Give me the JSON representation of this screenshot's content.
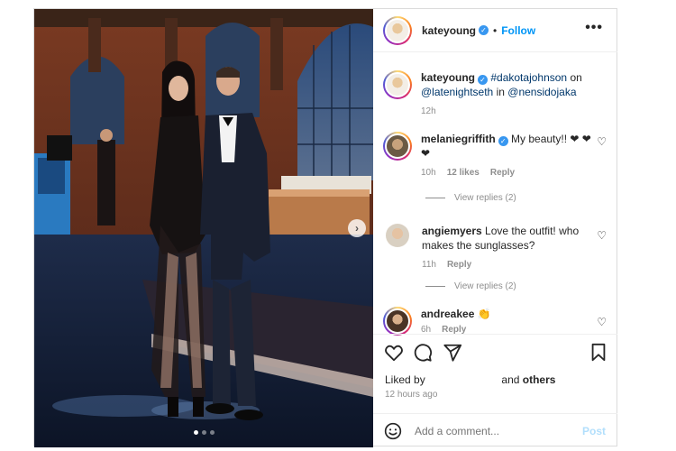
{
  "header": {
    "username": "kateyoung",
    "separator": "•",
    "follow_label": "Follow"
  },
  "caption": {
    "username": "kateyoung",
    "tag1": "#dakotajohnson",
    "word_on": "on",
    "mention1": "@latenightseth",
    "word_in": "in",
    "mention2": "@nensidojaka",
    "time": "12h"
  },
  "comments": [
    {
      "username": "melaniegriffith",
      "text": "My beauty!! ❤ ❤ ❤",
      "time": "10h",
      "likes": "12 likes",
      "reply": "Reply",
      "view_replies": "View replies (2)"
    },
    {
      "username": "angiemyers",
      "text": "Love the outfit! who makes the sunglasses?",
      "time": "11h",
      "reply": "Reply",
      "view_replies": "View replies (2)"
    },
    {
      "username": "andreakee",
      "text": "👏",
      "time": "6h",
      "reply": "Reply"
    }
  ],
  "liked_by": {
    "prefix": "Liked by",
    "and": "and",
    "others": "others"
  },
  "timestamp": "12 hours ago",
  "add_comment": {
    "placeholder": "Add a comment...",
    "post_label": "Post"
  },
  "colors": {
    "accent": "#0095f6",
    "heart": "#ed4956",
    "link": "#00376b",
    "muted": "#8e8e8e"
  },
  "icons": [
    "more-icon",
    "heart-icon",
    "comment-icon",
    "share-icon",
    "bookmark-icon",
    "emoji-icon",
    "next-arrow-icon",
    "verified-icon"
  ]
}
